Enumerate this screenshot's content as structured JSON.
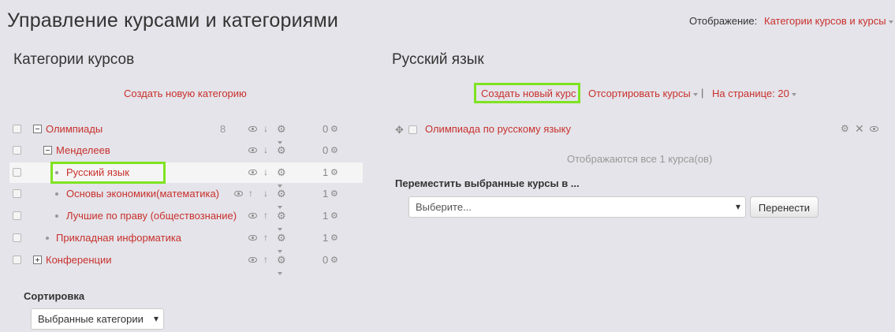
{
  "page_title": "Управление курсами и категориями",
  "view": {
    "label": "Отображение:",
    "value": "Категории курсов и курсы"
  },
  "categories_panel": {
    "title": "Категории курсов",
    "create_label": "Создать новую категорию",
    "items": [
      {
        "name": "Олимпиады",
        "count": "8",
        "courses": "0"
      },
      {
        "name": "Менделеев",
        "count": "",
        "courses": "0"
      },
      {
        "name": "Русский язык",
        "count": "",
        "courses": "1"
      },
      {
        "name": "Основы экономики(математика)",
        "count": "",
        "courses": "1"
      },
      {
        "name": "Лучшие по праву (обществознание)",
        "count": "",
        "courses": "1"
      },
      {
        "name": "Прикладная информатика",
        "count": "",
        "courses": "1"
      },
      {
        "name": "Конференции",
        "count": "",
        "courses": "0"
      }
    ],
    "sort_label": "Сортировка",
    "sort_value": "Выбранные категории"
  },
  "courses_panel": {
    "title": "Русский язык",
    "create_label": "Создать новый курс",
    "sort_label": "Отсортировать курсы",
    "per_page_label": "На странице: 20",
    "courses": [
      {
        "name": "Олимпиада по русскому языку"
      }
    ],
    "shown_text": "Отображаются все 1 курса(ов)",
    "move_label": "Переместить выбранные курсы в ...",
    "move_select_value": "Выберите...",
    "move_button": "Перенести"
  },
  "colors": {
    "link": "#c9302c",
    "highlight": "#7fe321",
    "background": "#e4e4ea"
  },
  "icons": [
    "expand-icon",
    "collapse-icon",
    "eye-icon",
    "arrow-up-icon",
    "arrow-down-icon",
    "gear-icon",
    "courses-icon",
    "move-icon",
    "delete-icon"
  ]
}
